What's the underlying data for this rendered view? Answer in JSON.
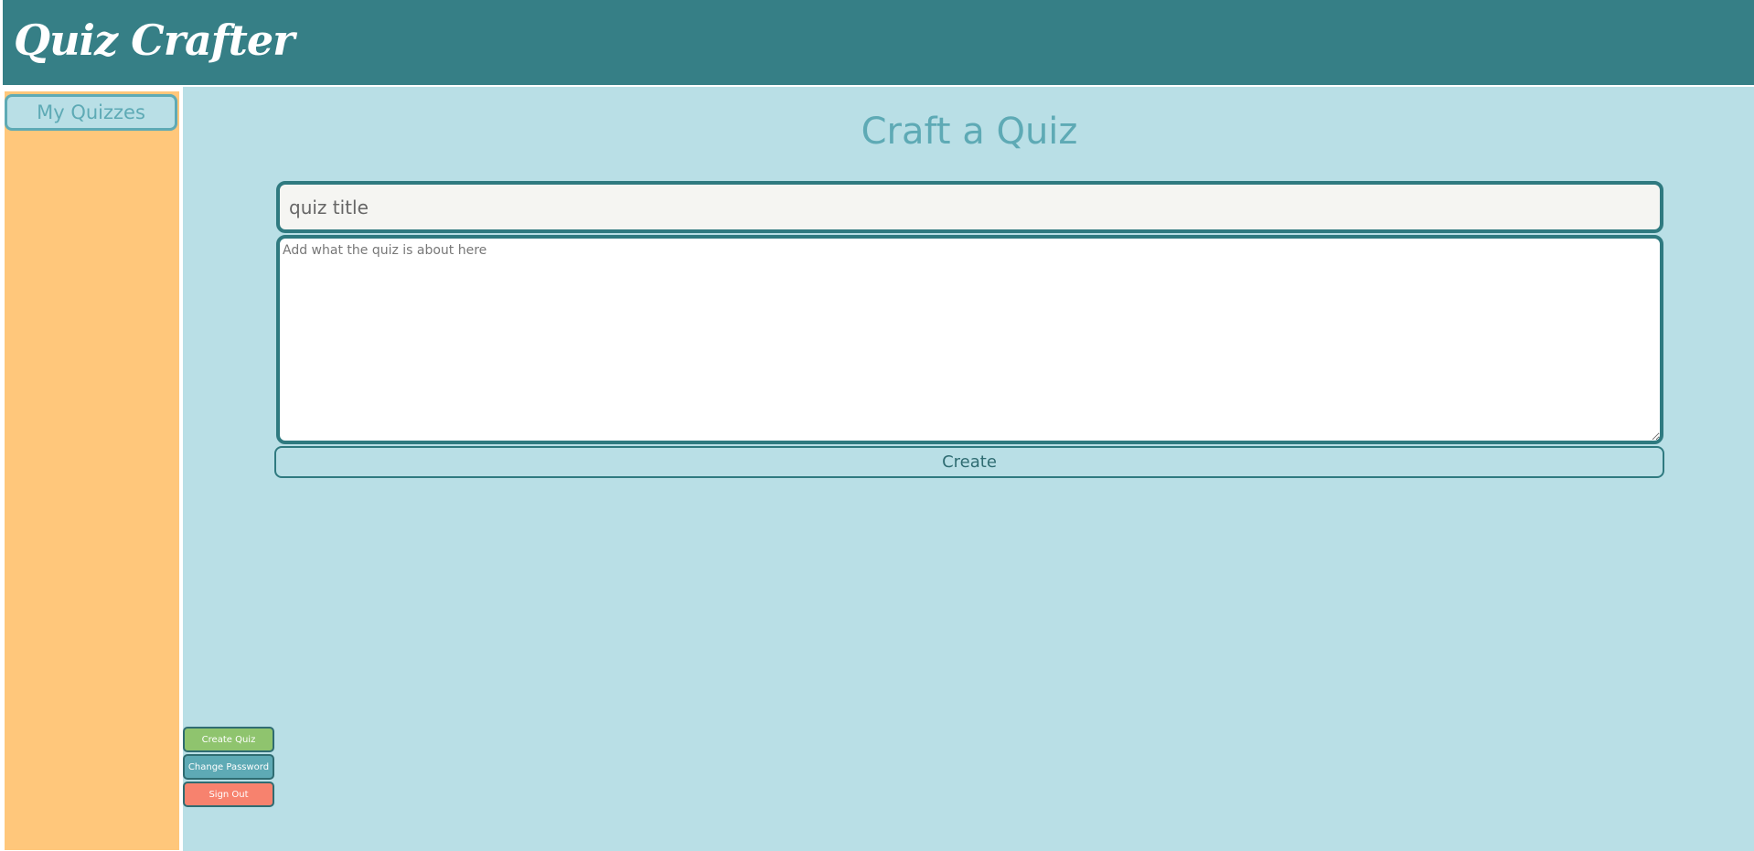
{
  "app": {
    "logo": "Quiz Crafter"
  },
  "sidebar": {
    "my_quizzes_label": "My Quizzes"
  },
  "main": {
    "title": "Craft a Quiz",
    "title_input": {
      "value": "",
      "placeholder": "quiz title"
    },
    "description_input": {
      "value": "",
      "placeholder": "Add what the quiz is about here"
    },
    "create_label": "Create"
  },
  "actions": {
    "create_quiz_label": "Create Quiz",
    "change_password_label": "Change Password",
    "sign_out_label": "Sign Out"
  },
  "colors": {
    "header": "#367f86",
    "sidebar": "#ffc77b",
    "main_background": "#b9dfe6",
    "accent": "#5eaab5",
    "border": "#2f7a80",
    "create_quiz": "#8fc46e",
    "change_password": "#5eaab5",
    "sign_out": "#f7826e"
  }
}
